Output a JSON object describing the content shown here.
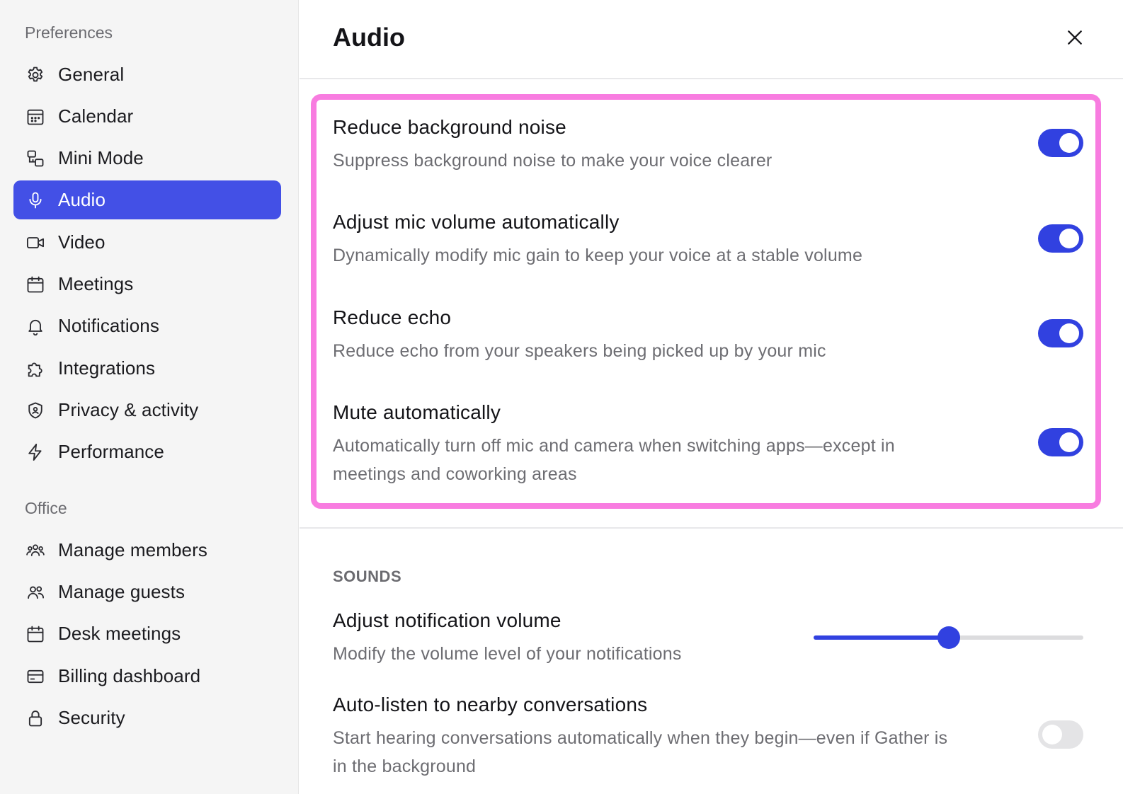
{
  "sidebar": {
    "preferences_label": "Preferences",
    "office_label": "Office",
    "preferences": [
      {
        "label": "General",
        "icon": "gear-icon"
      },
      {
        "label": "Calendar",
        "icon": "calendar-grid-icon"
      },
      {
        "label": "Mini Mode",
        "icon": "mini-mode-icon"
      },
      {
        "label": "Audio",
        "icon": "microphone-icon",
        "active": true
      },
      {
        "label": "Video",
        "icon": "video-camera-icon"
      },
      {
        "label": "Meetings",
        "icon": "calendar-icon"
      },
      {
        "label": "Notifications",
        "icon": "bell-icon"
      },
      {
        "label": "Integrations",
        "icon": "puzzle-icon"
      },
      {
        "label": "Privacy & activity",
        "icon": "shield-icon"
      },
      {
        "label": "Performance",
        "icon": "lightning-icon"
      }
    ],
    "office": [
      {
        "label": "Manage members",
        "icon": "members-icon"
      },
      {
        "label": "Manage guests",
        "icon": "guests-icon"
      },
      {
        "label": "Desk meetings",
        "icon": "calendar-icon"
      },
      {
        "label": "Billing dashboard",
        "icon": "card-icon"
      },
      {
        "label": "Security",
        "icon": "lock-icon"
      }
    ]
  },
  "main": {
    "title": "Audio",
    "settings": [
      {
        "title": "Reduce background noise",
        "desc": "Suppress background noise to make your voice clearer",
        "enabled": true
      },
      {
        "title": "Adjust mic volume automatically",
        "desc": "Dynamically modify mic gain to keep your voice at a stable volume",
        "enabled": true
      },
      {
        "title": "Reduce echo",
        "desc": "Reduce echo from your speakers being picked up by your mic",
        "enabled": true
      },
      {
        "title": "Mute automatically",
        "desc": "Automatically turn off mic and camera when switching apps—except in meetings and coworking areas",
        "enabled": true
      }
    ],
    "sounds": {
      "label": "SOUNDS",
      "notification_volume": {
        "title": "Adjust notification volume",
        "desc": "Modify the volume level of your notifications",
        "value_percent": 50
      },
      "auto_listen": {
        "title": "Auto-listen to nearby conversations",
        "desc": "Start hearing conversations automatically when they begin—even if Gather is in the background",
        "enabled": false
      }
    }
  },
  "colors": {
    "accent": "#3141e0",
    "active_nav": "#4350e6",
    "highlight_border": "#f87ce0"
  }
}
